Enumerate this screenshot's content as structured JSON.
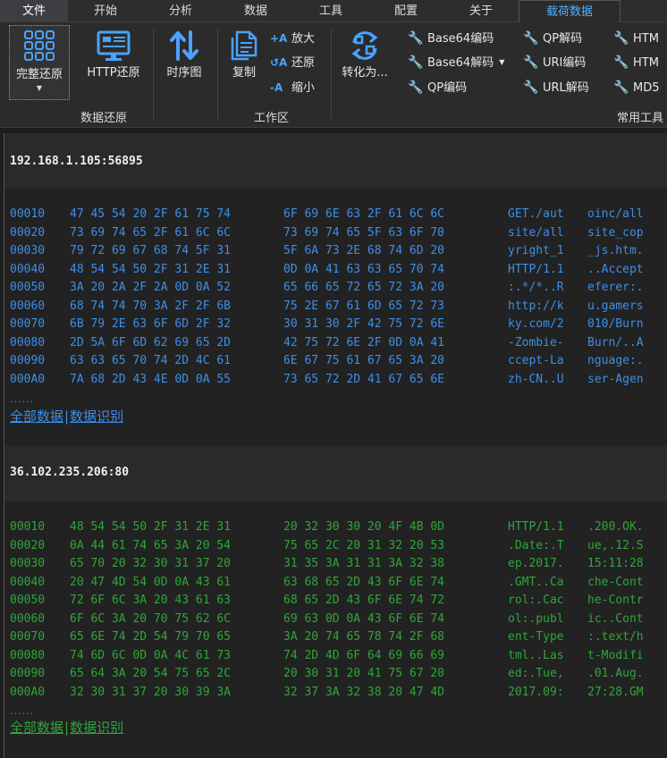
{
  "menubar": {
    "items": [
      "文件",
      "开始",
      "分析",
      "数据",
      "工具",
      "配置",
      "关于",
      "载荷数据"
    ]
  },
  "ribbon": {
    "restore_group": {
      "full_restore": "完整还原",
      "http_restore": "HTTP还原",
      "sequence": "时序图",
      "label": "数据还原"
    },
    "workspace_group": {
      "copy": "复制",
      "zoom_in": "放大",
      "reset": "还原",
      "zoom_out": "缩小",
      "label": "工作区"
    },
    "tools_group": {
      "convert": "转化为...",
      "tools": [
        "Base64编码",
        "Base64解码",
        "QP编码",
        "QP解码",
        "URI编码",
        "URL解码",
        "HTM",
        "HTM",
        "MD5"
      ],
      "label": "常用工具"
    },
    "accent_color": "#4aa3ff"
  },
  "sessions": [
    {
      "address": "192.168.1.105:56895",
      "color": "#3d8fe8",
      "rows": [
        {
          "offset": "00010",
          "hex1": "47 45 54 20 2F 61 75 74",
          "hex2": "6F 69 6E 63 2F 61 6C 6C",
          "ascii1": "GET./aut",
          "ascii2": "oinc/all"
        },
        {
          "offset": "00020",
          "hex1": "73 69 74 65 2F 61 6C 6C",
          "hex2": "73 69 74 65 5F 63 6F 70",
          "ascii1": "site/all",
          "ascii2": "site_cop"
        },
        {
          "offset": "00030",
          "hex1": "79 72 69 67 68 74 5F 31",
          "hex2": "5F 6A 73 2E 68 74 6D 20",
          "ascii1": "yright_1",
          "ascii2": "_js.htm."
        },
        {
          "offset": "00040",
          "hex1": "48 54 54 50 2F 31 2E 31",
          "hex2": "0D 0A 41 63 63 65 70 74",
          "ascii1": "HTTP/1.1",
          "ascii2": "..Accept"
        },
        {
          "offset": "00050",
          "hex1": "3A 20 2A 2F 2A 0D 0A 52",
          "hex2": "65 66 65 72 65 72 3A 20",
          "ascii1": ":.*/*..R",
          "ascii2": "eferer:."
        },
        {
          "offset": "00060",
          "hex1": "68 74 74 70 3A 2F 2F 6B",
          "hex2": "75 2E 67 61 6D 65 72 73",
          "ascii1": "http://k",
          "ascii2": "u.gamers"
        },
        {
          "offset": "00070",
          "hex1": "6B 79 2E 63 6F 6D 2F 32",
          "hex2": "30 31 30 2F 42 75 72 6E",
          "ascii1": "ky.com/2",
          "ascii2": "010/Burn"
        },
        {
          "offset": "00080",
          "hex1": "2D 5A 6F 6D 62 69 65 2D",
          "hex2": "42 75 72 6E 2F 0D 0A 41",
          "ascii1": "-Zombie-",
          "ascii2": "Burn/..A"
        },
        {
          "offset": "00090",
          "hex1": "63 63 65 70 74 2D 4C 61",
          "hex2": "6E 67 75 61 67 65 3A 20",
          "ascii1": "ccept-La",
          "ascii2": "nguage:."
        },
        {
          "offset": "000A0",
          "hex1": "7A 68 2D 43 4E 0D 0A 55",
          "hex2": "73 65 72 2D 41 67 65 6E",
          "ascii1": "zh-CN..U",
          "ascii2": "ser-Agen"
        }
      ],
      "more": "......",
      "link_all": "全部数据",
      "link_sep": "|",
      "link_identify": "数据识别"
    },
    {
      "address": "36.102.235.206:80",
      "color": "#2fa63a",
      "rows": [
        {
          "offset": "00010",
          "hex1": "48 54 54 50 2F 31 2E 31",
          "hex2": "20 32 30 30 20 4F 4B 0D",
          "ascii1": "HTTP/1.1",
          "ascii2": ".200.OK."
        },
        {
          "offset": "00020",
          "hex1": "0A 44 61 74 65 3A 20 54",
          "hex2": "75 65 2C 20 31 32 20 53",
          "ascii1": ".Date:.T",
          "ascii2": "ue,.12.S"
        },
        {
          "offset": "00030",
          "hex1": "65 70 20 32 30 31 37 20",
          "hex2": "31 35 3A 31 31 3A 32 38",
          "ascii1": "ep.2017.",
          "ascii2": "15:11:28"
        },
        {
          "offset": "00040",
          "hex1": "20 47 4D 54 0D 0A 43 61",
          "hex2": "63 68 65 2D 43 6F 6E 74",
          "ascii1": ".GMT..Ca",
          "ascii2": "che-Cont"
        },
        {
          "offset": "00050",
          "hex1": "72 6F 6C 3A 20 43 61 63",
          "hex2": "68 65 2D 43 6F 6E 74 72",
          "ascii1": "rol:.Cac",
          "ascii2": "he-Contr"
        },
        {
          "offset": "00060",
          "hex1": "6F 6C 3A 20 70 75 62 6C",
          "hex2": "69 63 0D 0A 43 6F 6E 74",
          "ascii1": "ol:.publ",
          "ascii2": "ic..Cont"
        },
        {
          "offset": "00070",
          "hex1": "65 6E 74 2D 54 79 70 65",
          "hex2": "3A 20 74 65 78 74 2F 68",
          "ascii1": "ent-Type",
          "ascii2": ":.text/h"
        },
        {
          "offset": "00080",
          "hex1": "74 6D 6C 0D 0A 4C 61 73",
          "hex2": "74 2D 4D 6F 64 69 66 69",
          "ascii1": "tml..Las",
          "ascii2": "t-Modifi"
        },
        {
          "offset": "00090",
          "hex1": "65 64 3A 20 54 75 65 2C",
          "hex2": "20 30 31 20 41 75 67 20",
          "ascii1": "ed:.Tue,",
          "ascii2": ".01.Aug."
        },
        {
          "offset": "000A0",
          "hex1": "32 30 31 37 20 30 39 3A",
          "hex2": "32 37 3A 32 38 20 47 4D",
          "ascii1": "2017.09:",
          "ascii2": "27:28.GM"
        }
      ],
      "more": "......",
      "link_all": "全部数据",
      "link_sep": "|",
      "link_identify": "数据识别"
    }
  ]
}
